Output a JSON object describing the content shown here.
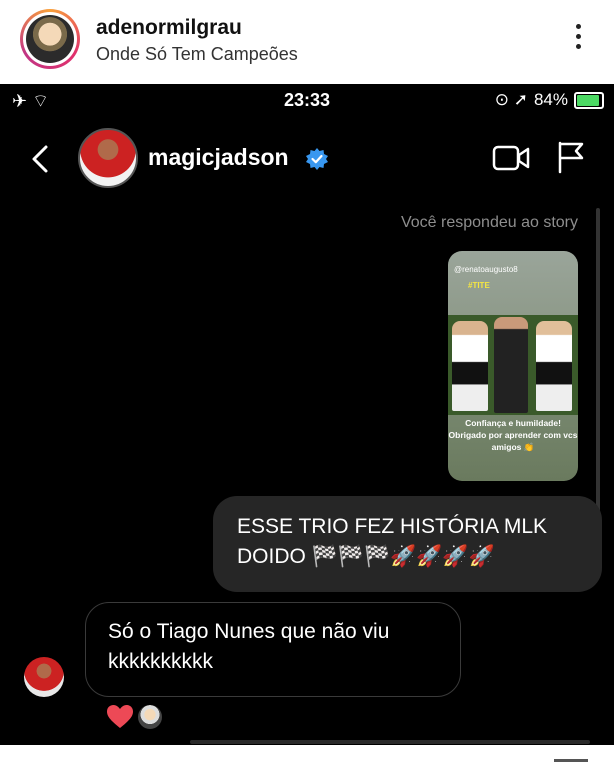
{
  "post": {
    "username": "adenormilgrau",
    "subtitle": "Onde Só Tem Campeões"
  },
  "status_bar": {
    "left_icons": "✈ ⌔",
    "time": "23:33",
    "location_glyphs": "⊙ ➚",
    "battery": "84%"
  },
  "dm_header": {
    "username": "magicjadson",
    "verified": true
  },
  "chat": {
    "replied_label": "Você respondeu ao story",
    "story": {
      "mention": "@renatoaugusto8",
      "hashtag": "#TITE",
      "caption": "Confiança e humildade! Obrigado por aprender com vcs amigos 👏"
    },
    "sent_message": "ESSE TRIO FEZ HISTÓRIA MLK DOIDO 🏁🏁🏁🚀🚀🚀🚀",
    "received_message": "Só o Tiago Nunes que não viu kkkkkkkkkk",
    "reaction": "❤️"
  },
  "colors": {
    "verified": "#3897f0",
    "bubble_sent": "#262626",
    "heart": "#ed4956"
  }
}
